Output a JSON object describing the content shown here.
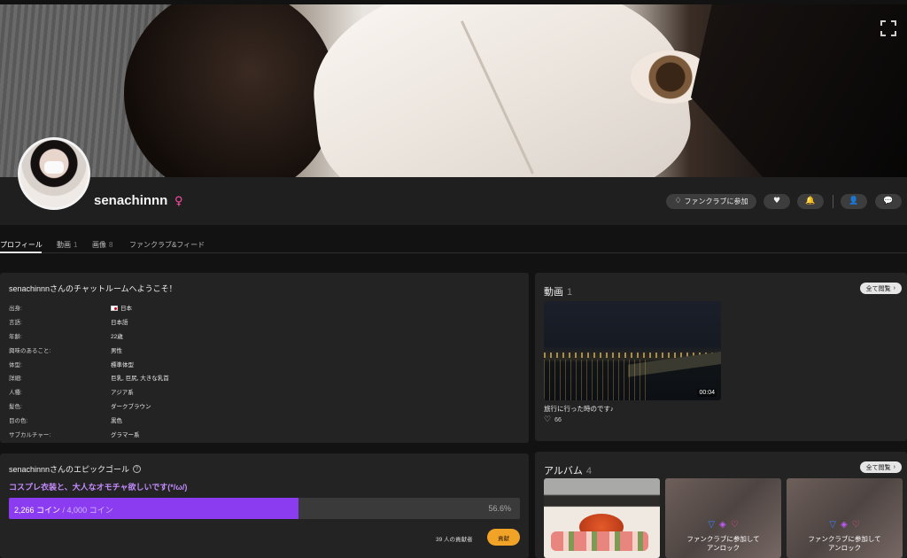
{
  "profile": {
    "username": "senachinnn",
    "gender_symbol": "♀",
    "actions": {
      "fanclub_label": "ファンクラブに参加"
    }
  },
  "tabs": [
    {
      "label": "プロフィール",
      "count": ""
    },
    {
      "label": "動画",
      "count": "1"
    },
    {
      "label": "画像",
      "count": "8"
    },
    {
      "label": "ファンクラブ&フィード",
      "count": ""
    }
  ],
  "info": {
    "title": "senachinnnさんのチャットルームへようこそ！",
    "rows": [
      {
        "key": "出身:",
        "value": "日本"
      },
      {
        "key": "言語:",
        "value": "日本語"
      },
      {
        "key": "年齢:",
        "value": "22歳"
      },
      {
        "key": "興味のあること:",
        "value": "男性"
      },
      {
        "key": "体型:",
        "value": "標準体型"
      },
      {
        "key": "詳細:",
        "value": "巨乳, 巨尻, 大きな乳首"
      },
      {
        "key": "人種:",
        "value": "アジア系"
      },
      {
        "key": "髪色:",
        "value": "ダークブラウン"
      },
      {
        "key": "目の色:",
        "value": "黒色"
      },
      {
        "key": "サブカルチャー:",
        "value": "グラマー系"
      }
    ]
  },
  "videos": {
    "title": "動画",
    "count": "1",
    "view_all": "全て閲覧",
    "items": [
      {
        "duration": "00:04",
        "caption": "旅行に行った時のです♪",
        "likes": "66"
      }
    ]
  },
  "goal": {
    "title": "senachinnnさんのエピックゴール",
    "description": "コスプレ衣装と、大人なオモチャ欲しいです(*/ω/)",
    "current": "2,266 コイン",
    "total": "/ 4,000 コイン",
    "percent_label": "56.6%",
    "progress": 0.566,
    "contributors": "39 人の貢献者",
    "contribute_label": "貢献"
  },
  "album": {
    "title": "アルバム",
    "count": "4",
    "view_all": "全て閲覧",
    "locked_line1": "ファンクラブに参加して",
    "locked_line2": "アンロック"
  },
  "colors": {
    "accent_purple": "#8c3cf0",
    "goal_text": "#c58cff",
    "contribute_orange": "#f0a327",
    "gender_pink": "#ff4fa3"
  }
}
